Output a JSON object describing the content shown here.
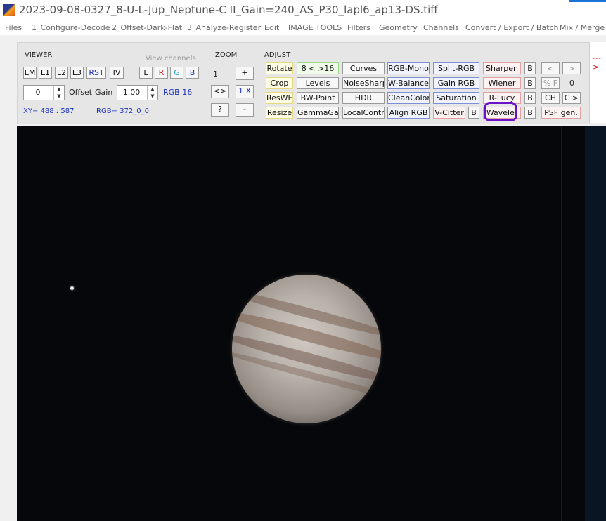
{
  "window": {
    "title": "2023-09-08-0327_8-U-L-Jup_Neptune-C II_Gain=240_AS_P30_lapl6_ap13-DS.tiff"
  },
  "menu": [
    "Files",
    "1_Configure-Decode",
    "2_Offset-Dark-Flat",
    "3_Analyze-Register",
    "Edit",
    "IMAGE TOOLS",
    "Filters",
    "Geometry",
    "Channels",
    "Convert / Export / Batch",
    "Mix / Merge"
  ],
  "viewer": {
    "label": "VIEWER",
    "view_channels_label": "View channels",
    "buttons": [
      "LM",
      "L1",
      "L2",
      "L3",
      "RST",
      "IV"
    ],
    "channels": [
      "L",
      "R",
      "G",
      "B"
    ],
    "offset_value": "0",
    "offset_label": "Offset",
    "gain_label": "Gain",
    "gain_value": "1.00",
    "rgb_depth": "RGB 16",
    "xy_readout": "XY=  488 : 587",
    "rgb_readout": "RGB=  372_0_0"
  },
  "zoom": {
    "label": "ZOOM",
    "level": "1",
    "plus": "+",
    "minus": "-",
    "fit": "<>",
    "one_x": "1 X",
    "help": "?"
  },
  "adjust": {
    "label": "ADJUST",
    "col1": [
      "Rotate",
      "Crop",
      "ResWH",
      "Resize"
    ],
    "col2": [
      "8 < >16",
      "Levels",
      "BW-Point",
      "GammaGain"
    ],
    "col3": [
      "Curves",
      "NoiseSharp",
      "HDR",
      "LocalContr"
    ],
    "col4": [
      "RGB-Mono",
      "W-Balance",
      "CleanColor",
      "Align RGB"
    ],
    "col5": [
      "Split-RGB",
      "Gain RGB",
      "Saturation",
      "V-Citter"
    ],
    "col5_b": "B",
    "col6": [
      "Sharpen",
      "Wiener",
      "R-Lucy",
      "Wavelet"
    ],
    "col6_b": "B",
    "nav_prev": "<",
    "nav_next": ">",
    "percent_f": "% F",
    "counter": "0",
    "ch": "CH",
    "c_next": "C >",
    "psf": "PSF gen."
  },
  "right_strip": {
    "arrow": "--->"
  }
}
